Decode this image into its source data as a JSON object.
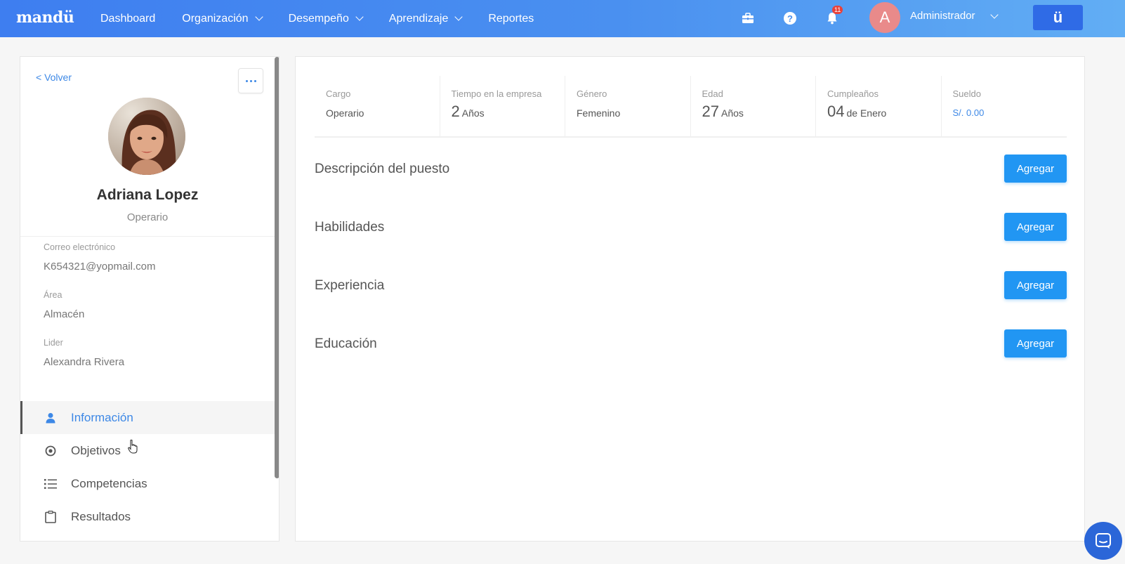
{
  "header": {
    "logo": "mandü",
    "nav": [
      {
        "label": "Dashboard",
        "dropdown": false
      },
      {
        "label": "Organización",
        "dropdown": true
      },
      {
        "label": "Desempeño",
        "dropdown": true
      },
      {
        "label": "Aprendizaje",
        "dropdown": true
      },
      {
        "label": "Reportes",
        "dropdown": false
      }
    ],
    "icons": [
      "briefcase-icon",
      "help-icon",
      "bell-icon"
    ],
    "notification_count": "11",
    "user_initial": "A",
    "user_name": "Administrador",
    "brand_button": "ü",
    "colors": {
      "bar_start": "#3e7ef0",
      "bar_end": "#62aef4",
      "brand_button": "#2f6be6"
    }
  },
  "profile": {
    "back_label": "< Volver",
    "name": "Adriana Lopez",
    "role": "Operario",
    "email_label": "Correo electrónico",
    "email": "K654321@yopmail.com",
    "area_label": "Área",
    "area": "Almacén",
    "leader_label": "Lider",
    "leader": "Alexandra Rivera",
    "menu": [
      {
        "label": "Información",
        "icon": "user-icon",
        "active": true
      },
      {
        "label": "Objetivos",
        "icon": "target-icon",
        "active": false
      },
      {
        "label": "Competencias",
        "icon": "list-icon",
        "active": false
      },
      {
        "label": "Resultados",
        "icon": "clipboard-icon",
        "active": false
      }
    ]
  },
  "stats": {
    "cargo_label": "Cargo",
    "cargo": "Operario",
    "tiempo_label": "Tiempo en la empresa",
    "tiempo_value": "2",
    "tiempo_unit": "Años",
    "genero_label": "Género",
    "genero": "Femenino",
    "edad_label": "Edad",
    "edad_value": "27",
    "edad_unit": "Años",
    "cumple_label": "Cumpleaños",
    "cumple_day": "04",
    "cumple_month": "de Enero",
    "sueldo_label": "Sueldo",
    "sueldo": "S/. 0.00"
  },
  "sections": [
    {
      "title": "Descripción del puesto",
      "button": "Agregar"
    },
    {
      "title": "Habilidades",
      "button": "Agregar"
    },
    {
      "title": "Experiencia",
      "button": "Agregar"
    },
    {
      "title": "Educación",
      "button": "Agregar"
    }
  ],
  "accent_color": "#2196f3",
  "link_color": "#3d88e6"
}
